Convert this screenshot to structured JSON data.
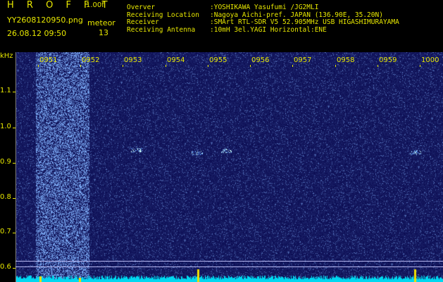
{
  "header": {
    "logo": "H R O F F T",
    "version": "1.00f",
    "filename": "YY2608120950.png",
    "datetime": "26.08.12 09:50",
    "meteor_label": "meteor",
    "meteor_count": "13",
    "info": [
      {
        "key": "Overver",
        "value": ":YOSHIKAWA Yasufumi /JG2MLI"
      },
      {
        "key": "Receiving Location",
        "value": ":Nagoya Aichi-pref. JAPAN (136.90E, 35.20N)"
      },
      {
        "key": "Receiver",
        "value": ":SMArt RTL-SDR V5 52.905MHz USB HIGASHIMURAYAMA"
      },
      {
        "key": "Receiving Antenna",
        "value": ":10mH 3el.YAGI Horizontal:ENE"
      }
    ]
  },
  "plot": {
    "y_unit": "kHz",
    "y_ticks": [
      "1.1",
      "1.0",
      "0.9",
      "0.8",
      "0.7",
      "0.6"
    ],
    "x_ticks": [
      "0951",
      "0952",
      "0953",
      "0954",
      "0955",
      "0956",
      "0957",
      "0958",
      "0959",
      "1000"
    ]
  },
  "colors": {
    "text": "#e8e800",
    "background": "#000000",
    "noise_base": "#0a0a6e",
    "noise_bright": "#78b4ff",
    "baseline": "#00e8ff"
  }
}
